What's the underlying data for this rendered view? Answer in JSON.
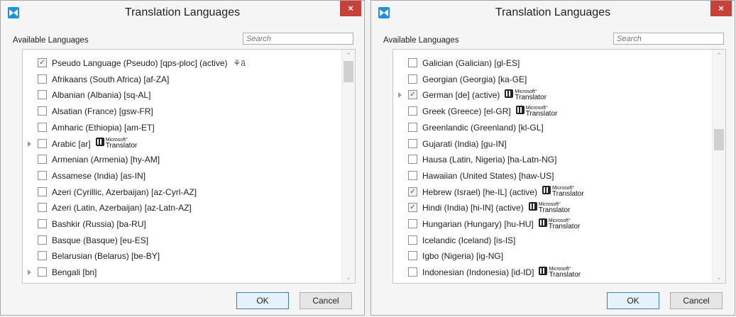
{
  "left_dialog": {
    "title": "Translation Languages",
    "close": "×",
    "available_label": "Available Languages",
    "search_placeholder": "Search",
    "ok_label": "OK",
    "cancel_label": "Cancel",
    "scroll_position": 0.0,
    "items": [
      {
        "label": "Pseudo Language (Pseudo) [qps-ploc] (active)",
        "checked": true,
        "expandable": false,
        "translator": false,
        "pseudo_icon": true
      },
      {
        "label": "Afrikaans (South Africa) [af-ZA]",
        "checked": false,
        "expandable": false,
        "translator": false
      },
      {
        "label": "Albanian (Albania) [sq-AL]",
        "checked": false,
        "expandable": false,
        "translator": false
      },
      {
        "label": "Alsatian (France) [gsw-FR]",
        "checked": false,
        "expandable": false,
        "translator": false
      },
      {
        "label": "Amharic (Ethiopia) [am-ET]",
        "checked": false,
        "expandable": false,
        "translator": false
      },
      {
        "label": "Arabic [ar]",
        "checked": false,
        "expandable": true,
        "translator": true
      },
      {
        "label": "Armenian (Armenia) [hy-AM]",
        "checked": false,
        "expandable": false,
        "translator": false
      },
      {
        "label": "Assamese (India) [as-IN]",
        "checked": false,
        "expandable": false,
        "translator": false
      },
      {
        "label": "Azeri (Cyrillic, Azerbaijan) [az-Cyrl-AZ]",
        "checked": false,
        "expandable": false,
        "translator": false
      },
      {
        "label": "Azeri (Latin, Azerbaijan) [az-Latn-AZ]",
        "checked": false,
        "expandable": false,
        "translator": false
      },
      {
        "label": "Bashkir (Russia) [ba-RU]",
        "checked": false,
        "expandable": false,
        "translator": false
      },
      {
        "label": "Basque (Basque) [eu-ES]",
        "checked": false,
        "expandable": false,
        "translator": false
      },
      {
        "label": "Belarusian (Belarus) [be-BY]",
        "checked": false,
        "expandable": false,
        "translator": false
      },
      {
        "label": "Bengali [bn]",
        "checked": false,
        "expandable": true,
        "translator": false
      }
    ]
  },
  "right_dialog": {
    "title": "Translation Languages",
    "close": "×",
    "available_label": "Available Languages",
    "search_placeholder": "Search",
    "ok_label": "OK",
    "cancel_label": "Cancel",
    "scroll_position": 0.36,
    "items": [
      {
        "label": "Galician (Galician) [gl-ES]",
        "checked": false,
        "expandable": false,
        "translator": false
      },
      {
        "label": "Georgian (Georgia) [ka-GE]",
        "checked": false,
        "expandable": false,
        "translator": false
      },
      {
        "label": "German [de] (active)",
        "checked": true,
        "expandable": true,
        "translator": true
      },
      {
        "label": "Greek (Greece) [el-GR]",
        "checked": false,
        "expandable": false,
        "translator": true
      },
      {
        "label": "Greenlandic (Greenland) [kl-GL]",
        "checked": false,
        "expandable": false,
        "translator": false
      },
      {
        "label": "Gujarati (India) [gu-IN]",
        "checked": false,
        "expandable": false,
        "translator": false
      },
      {
        "label": "Hausa (Latin, Nigeria) [ha-Latn-NG]",
        "checked": false,
        "expandable": false,
        "translator": false
      },
      {
        "label": "Hawaiian (United States) [haw-US]",
        "checked": false,
        "expandable": false,
        "translator": false
      },
      {
        "label": "Hebrew (Israel) [he-IL] (active)",
        "checked": true,
        "expandable": false,
        "translator": true
      },
      {
        "label": "Hindi (India) [hi-IN] (active)",
        "checked": true,
        "expandable": false,
        "translator": true
      },
      {
        "label": "Hungarian (Hungary) [hu-HU]",
        "checked": false,
        "expandable": false,
        "translator": true
      },
      {
        "label": "Icelandic (Iceland) [is-IS]",
        "checked": false,
        "expandable": false,
        "translator": false
      },
      {
        "label": "Igbo (Nigeria) [ig-NG]",
        "checked": false,
        "expandable": false,
        "translator": false
      },
      {
        "label": "Indonesian (Indonesia) [id-ID]",
        "checked": false,
        "expandable": false,
        "translator": true
      }
    ]
  },
  "translator_badge": {
    "line1": "Microsoft",
    "line2": "Translator"
  },
  "icons": {
    "app": "visual-studio-icon",
    "pseudo": "pseudo-language-icon",
    "translator": "microsoft-translator-icon"
  },
  "colors": {
    "close_button": "#c7413a",
    "accent_border": "#3c7fb1"
  }
}
